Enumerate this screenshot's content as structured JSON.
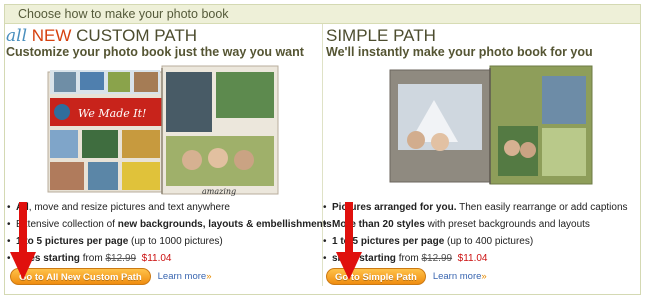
{
  "header": {
    "title": "Choose how to make your photo book"
  },
  "custom": {
    "title_all": "all",
    "title_new": "NEW",
    "title_rest": "CUSTOM PATH",
    "subtitle": "Customize your photo book just the way you want",
    "book_banner": "We Made It!",
    "book_caption": "amazing",
    "features": [
      {
        "bold": "All",
        "text": ", move and resize pictures and text anywhere"
      },
      {
        "pre": "Extensive collection of ",
        "bold": "new backgrounds, layouts & embellishments"
      },
      {
        "bold": "1 to 5 pictures per page",
        "text": " (up to 1000 pictures)"
      }
    ],
    "sizes_label": "sizes starting",
    "sizes_from": "from",
    "old_price": "$12.99",
    "new_price": "$11.04",
    "button_label": "Go to All New Custom Path",
    "learn_more": "Learn more",
    "learn_more_arrow": "»"
  },
  "simple": {
    "title": "SIMPLE PATH",
    "subtitle": "We'll instantly make your photo book for you",
    "features": [
      {
        "bold": "Pictures arranged for you.",
        "text": " Then easily rearrange or add captions"
      },
      {
        "pre": "More than 20 styles",
        "text": " with preset backgrounds and layouts"
      },
      {
        "bold": "1 to 5 pictures per page",
        "text": " (up to 400 pictures)"
      }
    ],
    "sizes_label": "sizes starting",
    "sizes_from": "from",
    "old_price": "$12.99",
    "new_price": "$11.04",
    "button_label": "Go to Simple Path",
    "learn_more": "Learn more",
    "learn_more_arrow": "»"
  },
  "colors": {
    "accent_orange": "#f08d10",
    "arrow_red": "#e0100d",
    "link_blue": "#3a66b0",
    "header_bg": "#eef0d8"
  }
}
